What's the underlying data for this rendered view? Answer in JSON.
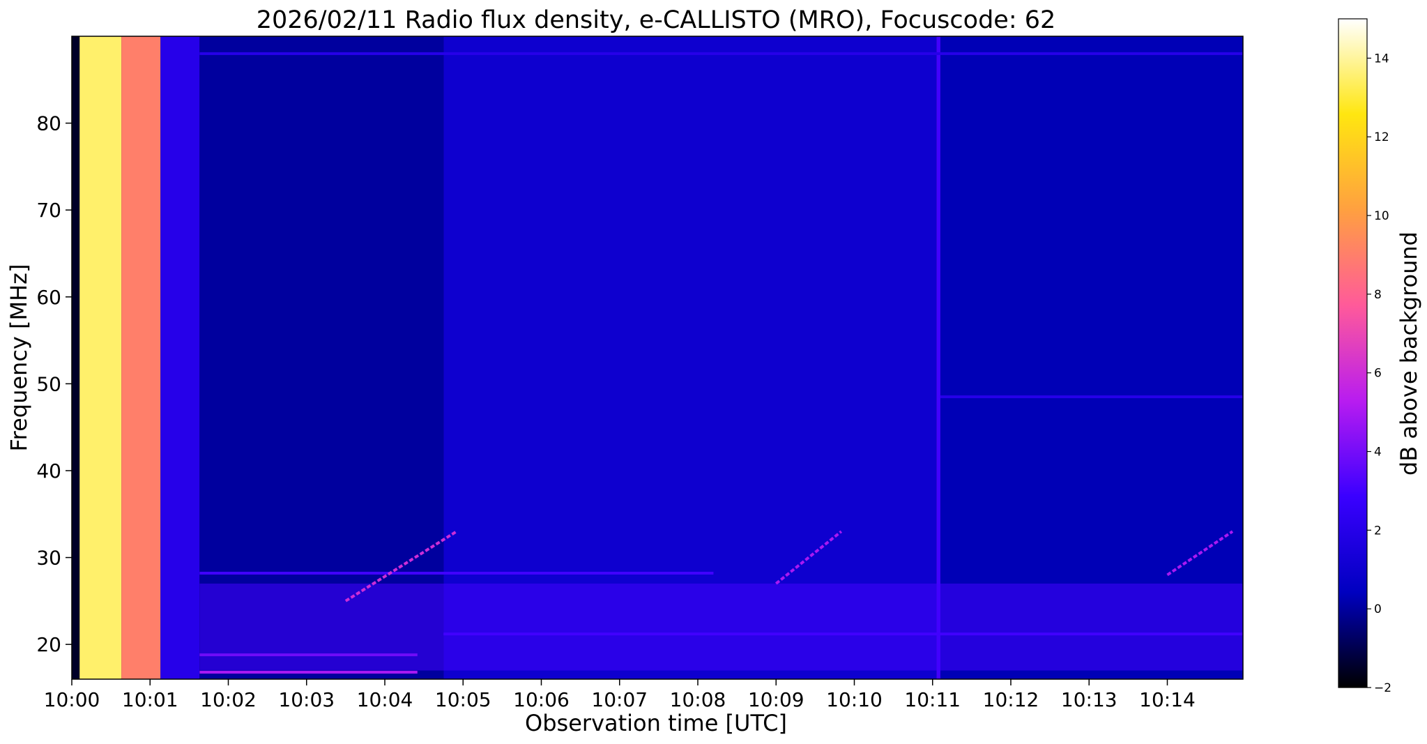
{
  "chart_data": {
    "type": "heatmap",
    "title": "2026/02/11  Radio flux density, e-CALLISTO (MRO), Focuscode: 62",
    "xlabel": "Observation time [UTC]",
    "ylabel": "Frequency [MHz]",
    "x_ticks": [
      "10:00",
      "10:01",
      "10:02",
      "10:03",
      "10:04",
      "10:05",
      "10:06",
      "10:07",
      "10:08",
      "10:09",
      "10:10",
      "10:11",
      "10:12",
      "10:13",
      "10:14"
    ],
    "xlim": [
      "10:00:00",
      "10:14:58"
    ],
    "y_ticks": [
      20,
      30,
      40,
      50,
      60,
      70,
      80
    ],
    "ylim": [
      16,
      90
    ],
    "colorbar": {
      "label": "dB above background",
      "ticks": [
        -2,
        0,
        2,
        4,
        6,
        8,
        10,
        12,
        14
      ],
      "range": [
        -2,
        15
      ],
      "colormap": "gnuplot2",
      "stops": [
        "#000000",
        "#0000c0",
        "#3a00ff",
        "#b81cf0",
        "#ff5a9a",
        "#ffa040",
        "#ffe610",
        "#ffffff"
      ]
    },
    "time_segments": [
      {
        "start": "10:00:00",
        "end": "10:00:06",
        "level_db": -1.5
      },
      {
        "start": "10:00:06",
        "end": "10:00:38",
        "level_db": 13.5
      },
      {
        "start": "10:00:38",
        "end": "10:01:08",
        "level_db": 9
      },
      {
        "start": "10:01:08",
        "end": "10:01:38",
        "level_db": 2
      },
      {
        "start": "10:01:38",
        "end": "10:04:45",
        "level_db": 0
      },
      {
        "start": "10:04:45",
        "end": "10:11:03",
        "level_db": 1
      },
      {
        "start": "10:11:03",
        "end": "10:11:06",
        "level_db": 3
      },
      {
        "start": "10:11:06",
        "end": "10:14:58",
        "level_db": 0.3
      }
    ],
    "features": [
      {
        "kind": "narrowband",
        "freq_mhz": 28.2,
        "start": "10:01:38",
        "end": "10:08:12",
        "level_db": 3
      },
      {
        "kind": "narrowband",
        "freq_mhz": 21.2,
        "start": "10:04:45",
        "end": "10:14:58",
        "level_db": 3
      },
      {
        "kind": "narrowband",
        "freq_mhz": 18.8,
        "start": "10:01:38",
        "end": "10:04:25",
        "level_db": 5
      },
      {
        "kind": "narrowband",
        "freq_mhz": 16.8,
        "start": "10:01:38",
        "end": "10:04:25",
        "level_db": 5
      },
      {
        "kind": "narrowband",
        "freq_mhz": 48.5,
        "start": "10:11:06",
        "end": "10:14:58",
        "level_db": 2
      },
      {
        "kind": "narrowband",
        "freq_mhz": 88.0,
        "start": "10:01:38",
        "end": "10:14:58",
        "level_db": 2
      },
      {
        "kind": "rfi_band",
        "freq_range_mhz": [
          17,
          27
        ],
        "start": "10:01:38",
        "end": "10:14:58",
        "level_db": 3
      },
      {
        "kind": "drifting_burst",
        "from": {
          "time": "10:03:30",
          "freq_mhz": 25
        },
        "to": {
          "time": "10:04:55",
          "freq_mhz": 33
        },
        "level_db": 6
      },
      {
        "kind": "drifting_burst",
        "from": {
          "time": "10:09:00",
          "freq_mhz": 27
        },
        "to": {
          "time": "10:09:50",
          "freq_mhz": 33
        },
        "level_db": 5
      },
      {
        "kind": "drifting_burst",
        "from": {
          "time": "10:14:00",
          "freq_mhz": 28
        },
        "to": {
          "time": "10:14:50",
          "freq_mhz": 33
        },
        "level_db": 5
      }
    ]
  }
}
